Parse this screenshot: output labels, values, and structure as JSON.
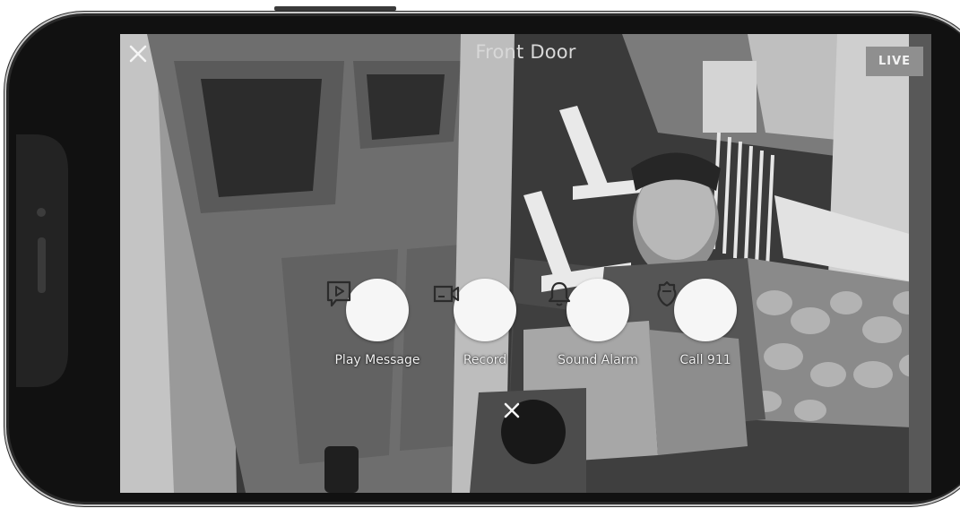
{
  "header": {
    "title": "Front Door",
    "live_badge": "LIVE",
    "close_icon": "close-icon"
  },
  "actions": [
    {
      "label": "Play Message",
      "icon": "play-message-icon"
    },
    {
      "label": "Record",
      "icon": "video-camera-icon"
    },
    {
      "label": "Sound Alarm",
      "icon": "bell-icon"
    },
    {
      "label": "Call 911",
      "icon": "police-badge-icon"
    }
  ],
  "dismiss": {
    "icon": "close-icon"
  },
  "colors": {
    "screen_background": "#3a3a3a",
    "action_circle": "#f6f6f6",
    "action_icon": "#2b2b2b",
    "live_badge": "#8f8f8f",
    "dismiss_button": "#181818"
  }
}
